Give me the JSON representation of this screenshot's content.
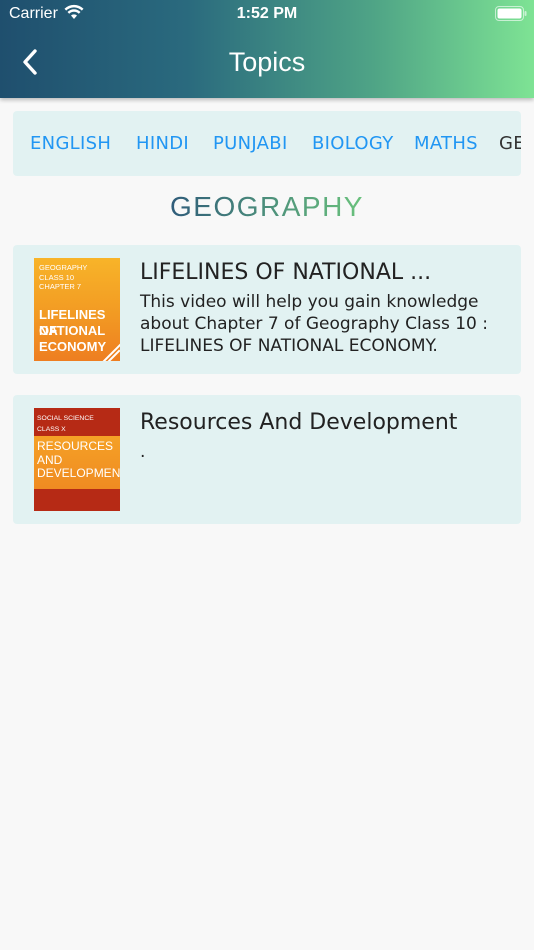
{
  "status_bar": {
    "carrier": "Carrier",
    "time": "1:52 PM"
  },
  "nav": {
    "title": "Topics",
    "back_icon": "chevron-left-icon"
  },
  "tabs": [
    {
      "label": "ENGLISH"
    },
    {
      "label": "HINDI"
    },
    {
      "label": "PUNJABI"
    },
    {
      "label": "BIOLOGY"
    },
    {
      "label": "MATHS"
    },
    {
      "label": "GE"
    }
  ],
  "section": {
    "title": "GEOGRAPHY",
    "gradient": [
      "#2f5c7a",
      "#6ac27c"
    ]
  },
  "cards": [
    {
      "title": "LIFELINES OF NATIONAL ...",
      "description": "This video will help you gain knowledge about Chapter 7 of Geography Class 10 : LIFELINES OF NATIONAL ECONOMY.",
      "thumb": {
        "small": [
          "GEOGRAPHY",
          "CLASS 10",
          "CHAPTER 7"
        ],
        "big": [
          "LIFELINES OF",
          "NATIONAL",
          "ECONOMY"
        ]
      }
    },
    {
      "title": "Resources And Development",
      "description": ".",
      "thumb": {
        "small": [
          "SOCIAL SCIENCE",
          "CLASS X"
        ],
        "big": [
          "RESOURCES",
          "AND",
          "DEVELOPMENT"
        ]
      }
    }
  ],
  "colors": {
    "header_start": "#1f4f6e",
    "header_end": "#7ee394",
    "tab_text": "#2196f3",
    "card_bg": "#e2f2f2"
  }
}
